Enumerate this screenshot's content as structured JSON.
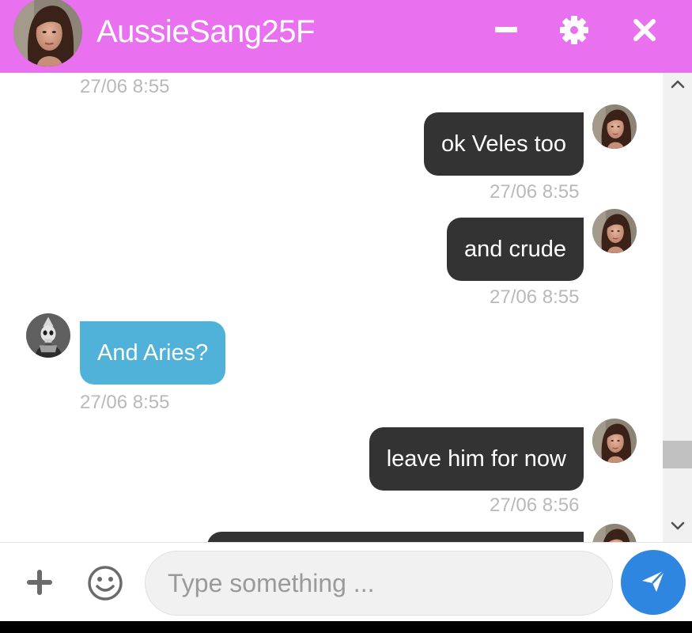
{
  "header": {
    "title": "AussieSang25F",
    "minimize_icon": "minus-icon",
    "settings_icon": "gear-icon",
    "close_icon": "close-icon"
  },
  "messages": [
    {
      "side": "in",
      "text": "",
      "time": "27/06 8:55"
    },
    {
      "side": "out",
      "text": "ok Veles too",
      "time": "27/06 8:55"
    },
    {
      "side": "out",
      "text": "and crude",
      "time": "27/06 8:55"
    },
    {
      "side": "in",
      "text": "And Aries?",
      "time": "27/06 8:55"
    },
    {
      "side": "out",
      "text": "leave him for now",
      "time": "27/06 8:56"
    },
    {
      "side": "out",
      "text": "",
      "time": ""
    }
  ],
  "composer": {
    "placeholder": "Type something ...",
    "add_icon": "plus-icon",
    "emoji_icon": "smiley-icon",
    "send_icon": "paper-plane-icon"
  },
  "colors": {
    "header": "#e970ef",
    "outgoing_bubble": "#333333",
    "incoming_bubble": "#50b2d9",
    "timestamp": "#b9b9b9",
    "send_button": "#2e86e0"
  }
}
